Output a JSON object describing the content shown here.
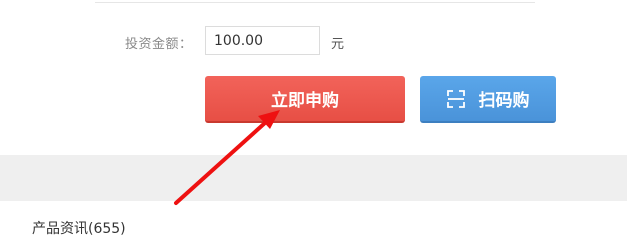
{
  "form": {
    "amount_label": "投资金额：",
    "amount_value": "100.00",
    "unit": "元"
  },
  "buttons": {
    "buy_label": "立即申购",
    "scan_label": "扫码购"
  },
  "section": {
    "title": "产品资讯(655)"
  },
  "colors": {
    "buy": "#ef5b52",
    "scan": "#5299e0",
    "annotation_arrow": "#ee1111"
  },
  "icons": {
    "scan": "scan-icon",
    "annotation": "red-arrow-icon"
  }
}
